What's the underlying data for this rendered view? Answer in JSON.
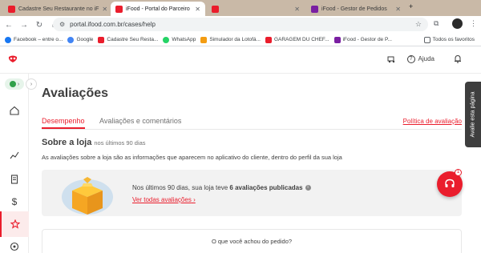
{
  "browser": {
    "tabs": [
      {
        "label": "Cadastre Seu Restaurante no iF",
        "active": false
      },
      {
        "label": "iFood - Portal do Parceiro",
        "active": true
      },
      {
        "label": "",
        "active": false
      },
      {
        "label": "iFood - Gestor de Pedidos",
        "active": false
      }
    ],
    "url": "portal.ifood.com.br/cases/help",
    "bookmarks": [
      {
        "label": "Facebook – entre o...",
        "icon": "facebook-icon"
      },
      {
        "label": "Google",
        "icon": "google-icon"
      },
      {
        "label": "Cadastre Seu Resta...",
        "icon": "ifood-icon"
      },
      {
        "label": "WhatsApp",
        "icon": "whatsapp-icon"
      },
      {
        "label": "Simulador da Lotofá...",
        "icon": "lottery-icon"
      },
      {
        "label": "GARAGEM DU CHEF...",
        "icon": "ifood-icon"
      },
      {
        "label": "iFood - Gestor de P...",
        "icon": "ifood-gestor-icon"
      }
    ],
    "all_bookmarks": "Todos os favoritos"
  },
  "topbar": {
    "help_label": "Ajuda"
  },
  "page": {
    "title": "Avaliações",
    "tabs": [
      "Desempenho",
      "Avaliações e comentários"
    ],
    "policy_link": "Política de avaliação",
    "section_title": "Sobre a loja",
    "section_subtitle": "nos últimos 90 dias",
    "section_description": "As avaliações sobre a loja são as informações que aparecem no aplicativo do cliente, dentro do perfil da sua loja",
    "summary_prefix": "Nos últimos 90 dias, sua loja teve ",
    "summary_bold": "6 avaliações publicadas",
    "summary_link": "Ver todas avaliações",
    "question": "O que você achou do pedido?"
  },
  "feedback_tab": "Avalie esta página",
  "chat_badge": "1",
  "colors": {
    "brand_red": "#ea1d2c",
    "status_green": "#30a04a",
    "card_bg": "#f2f2f2",
    "feedback_tab_bg": "#3e3e3e"
  }
}
